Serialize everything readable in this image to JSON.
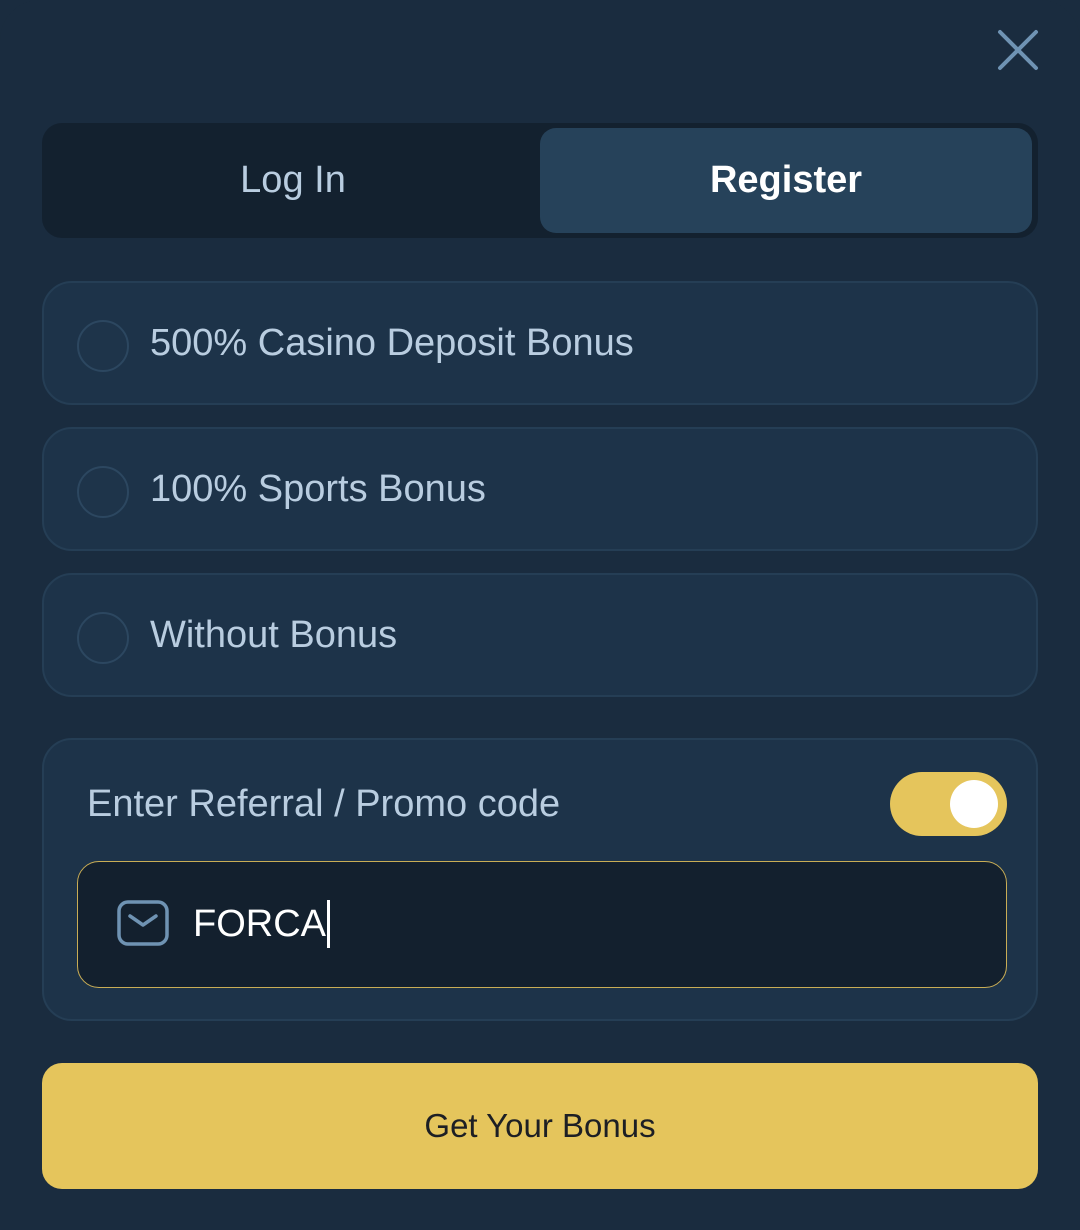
{
  "close": {
    "icon": "close-icon"
  },
  "tabs": [
    {
      "label": "Log In",
      "active": false
    },
    {
      "label": "Register",
      "active": true
    }
  ],
  "bonus_options": [
    {
      "label": "500% Casino Deposit Bonus",
      "selected": false
    },
    {
      "label": "100% Sports Bonus",
      "selected": false
    },
    {
      "label": "Without Bonus",
      "selected": false
    }
  ],
  "promo": {
    "label": "Enter Referral / Promo code",
    "toggle_on": true,
    "value": "FORCA",
    "icon": "envelope-icon"
  },
  "submit": {
    "label": "Get Your Bonus"
  },
  "colors": {
    "background": "#1a2c3f",
    "accent": "#e5c55c",
    "tab_active": "#26425a",
    "input_bg": "#13202e"
  }
}
